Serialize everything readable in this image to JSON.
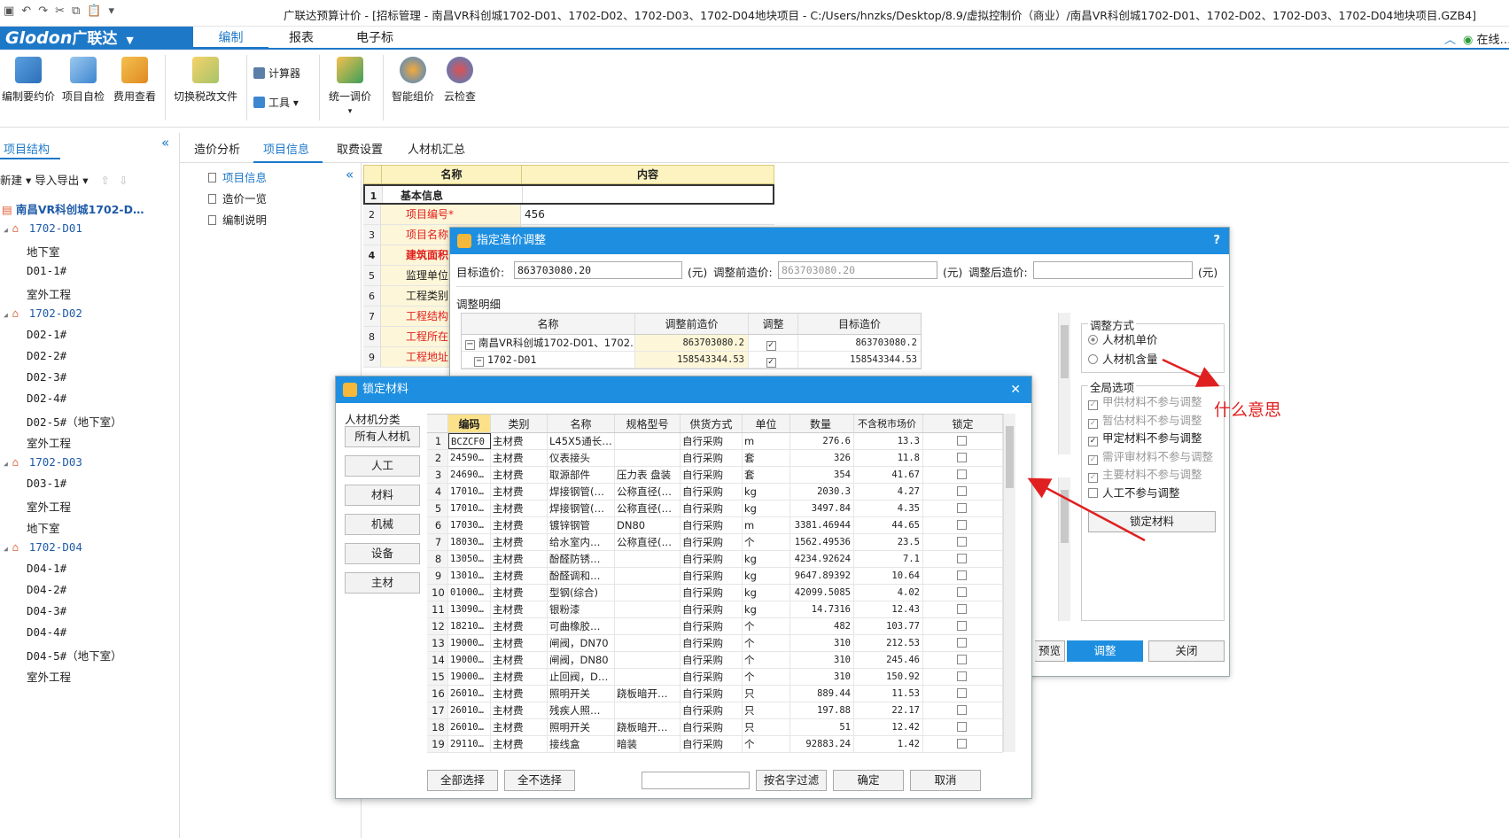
{
  "title": "广联达预算计价 - [招标管理 - 南昌VR科创城1702-D01、1702-D02、1702-D03、1702-D04地块项目 - C:/Users/hnzks/Desktop/8.9/虚拟控制价（商业）/南昌VR科创城1702-D01、1702-D02、1702-D03、1702-D04地块项目.GZB4]",
  "logo": {
    "brand": "Glodon",
    "cn": "广联达"
  },
  "menu": {
    "edit": "编制",
    "report": "报表",
    "ebid": "电子标"
  },
  "online": "在线…",
  "ribbon": {
    "b1": "编制要约价",
    "b2": "项目自检",
    "b3": "费用查看",
    "b4": "切换税改文件",
    "calc": "计算器",
    "tools": "工具",
    "b5": "统一调价",
    "b6": "智能组价",
    "b7": "云检查"
  },
  "left": {
    "tab": "项目结构",
    "tools": "新建 ▾   导入导出 ▾",
    "root": "南昌VR科创城1702-D…",
    "items": [
      {
        "t": "1702-D01",
        "lvl": "grp"
      },
      {
        "t": "地下室",
        "lvl": "leaf"
      },
      {
        "t": "D01-1#",
        "lvl": "leaf"
      },
      {
        "t": "室外工程",
        "lvl": "leaf"
      },
      {
        "t": "1702-D02",
        "lvl": "grp"
      },
      {
        "t": "D02-1#",
        "lvl": "leaf"
      },
      {
        "t": "D02-2#",
        "lvl": "leaf"
      },
      {
        "t": "D02-3#",
        "lvl": "leaf"
      },
      {
        "t": "D02-4#",
        "lvl": "leaf"
      },
      {
        "t": "D02-5#（地下室）",
        "lvl": "leaf"
      },
      {
        "t": "室外工程",
        "lvl": "leaf"
      },
      {
        "t": "1702-D03",
        "lvl": "grp"
      },
      {
        "t": "D03-1#",
        "lvl": "leaf"
      },
      {
        "t": "室外工程",
        "lvl": "leaf"
      },
      {
        "t": "地下室",
        "lvl": "leaf"
      },
      {
        "t": "1702-D04",
        "lvl": "grp"
      },
      {
        "t": "D04-1#",
        "lvl": "leaf"
      },
      {
        "t": "D04-2#",
        "lvl": "leaf"
      },
      {
        "t": "D04-3#",
        "lvl": "leaf"
      },
      {
        "t": "D04-4#",
        "lvl": "leaf"
      },
      {
        "t": "D04-5#（地下室）",
        "lvl": "leaf"
      },
      {
        "t": "室外工程",
        "lvl": "leaf"
      }
    ]
  },
  "subtabs": {
    "a": "造价分析",
    "b": "项目信息",
    "c": "取费设置",
    "d": "人材机汇总"
  },
  "infonav": {
    "a": "项目信息",
    "b": "造价一览",
    "c": "编制说明"
  },
  "infogrid": {
    "h_name": "名称",
    "h_content": "内容",
    "rows": [
      {
        "n": "1",
        "name": "基本信息",
        "val": "",
        "style": "group"
      },
      {
        "n": "2",
        "name": "项目编号*",
        "val": "456",
        "style": "red"
      },
      {
        "n": "3",
        "name": "项目名称",
        "val": "",
        "style": "red"
      },
      {
        "n": "4",
        "name": "建筑面积",
        "val": "",
        "style": "redbold"
      },
      {
        "n": "5",
        "name": "监理单位",
        "val": "",
        "style": "normal"
      },
      {
        "n": "6",
        "name": "工程类别",
        "val": "",
        "style": "normal"
      },
      {
        "n": "7",
        "name": "工程结构",
        "val": "",
        "style": "red"
      },
      {
        "n": "8",
        "name": "工程所在",
        "val": "",
        "style": "red"
      },
      {
        "n": "9",
        "name": "工程地址",
        "val": "",
        "style": "red"
      }
    ]
  },
  "dlg_price": {
    "title": "指定造价调整",
    "help": "?",
    "target_label": "目标造价:",
    "target_val": "863703080.20",
    "unit": "(元)",
    "before_label": "调整前造价:",
    "before_val": "863703080.20",
    "after_label": "调整后造价:",
    "after_val": "",
    "detail_label": "调整明细",
    "cols": [
      "名称",
      "调整前造价",
      "调整",
      "目标造价"
    ],
    "rows": [
      {
        "name": "南昌VR科创城1702-D01、1702…",
        "before": "863703080.2",
        "target": "863703080.2"
      },
      {
        "name": "1702-D01",
        "before": "158543344.53",
        "target": "158543344.53"
      }
    ],
    "mode_label": "调整方式",
    "mode_opts": [
      "人材机单价",
      "人材机含量"
    ],
    "global_label": "全局选项",
    "global_opts": [
      {
        "t": "甲供材料不参与调整",
        "checked": true,
        "dis": true
      },
      {
        "t": "暂估材料不参与调整",
        "checked": true,
        "dis": true
      },
      {
        "t": "甲定材料不参与调整",
        "checked": true,
        "dis": false
      },
      {
        "t": "需评审材料不参与调整",
        "checked": true,
        "dis": true
      },
      {
        "t": "主要材料不参与调整",
        "checked": true,
        "dis": true
      },
      {
        "t": "人工不参与调整",
        "checked": false,
        "dis": false
      }
    ],
    "lock_btn": "锁定材料",
    "preview": "预览",
    "adjust": "调整",
    "close": "关闭"
  },
  "dlg_lock": {
    "title": "锁定材料",
    "close": "✕",
    "cat_label": "人材机分类",
    "cats": [
      "所有人材机",
      "人工",
      "材料",
      "机械",
      "设备",
      "主材"
    ],
    "cols": [
      "编码",
      "类别",
      "名称",
      "规格型号",
      "供货方式",
      "单位",
      "数量",
      "不含税市场价",
      "锁定"
    ],
    "rows": [
      [
        "1",
        "BCZCF0",
        "主材费",
        "L45X5通长…",
        "",
        "自行采购",
        "m",
        "276.6",
        "13.3"
      ],
      [
        "2",
        "24590…",
        "主材费",
        "仪表接头",
        "",
        "自行采购",
        "套",
        "326",
        "11.8"
      ],
      [
        "3",
        "24690…",
        "主材费",
        "取源部件",
        "压力表 盘装",
        "自行采购",
        "套",
        "354",
        "41.67"
      ],
      [
        "4",
        "17010…",
        "主材费",
        "焊接钢管(…",
        "公称直径(…",
        "自行采购",
        "kg",
        "2030.3",
        "4.27"
      ],
      [
        "5",
        "17010…",
        "主材费",
        "焊接钢管(…",
        "公称直径(…",
        "自行采购",
        "kg",
        "3497.84",
        "4.35"
      ],
      [
        "6",
        "17030…",
        "主材费",
        "镀锌钢管",
        "DN80",
        "自行采购",
        "m",
        "3381.46944",
        "44.65"
      ],
      [
        "7",
        "18030…",
        "主材费",
        "给水室内…",
        "公称直径(…",
        "自行采购",
        "个",
        "1562.49536",
        "23.5"
      ],
      [
        "8",
        "13050…",
        "主材费",
        "酚醛防锈…",
        "",
        "自行采购",
        "kg",
        "4234.92624",
        "7.1"
      ],
      [
        "9",
        "13010…",
        "主材费",
        "酚醛调和…",
        "",
        "自行采购",
        "kg",
        "9647.89392",
        "10.64"
      ],
      [
        "10",
        "01000…",
        "主材费",
        "型钢(综合)",
        "",
        "自行采购",
        "kg",
        "42099.5085",
        "4.02"
      ],
      [
        "11",
        "13090…",
        "主材费",
        "银粉漆",
        "",
        "自行采购",
        "kg",
        "14.7316",
        "12.43"
      ],
      [
        "12",
        "18210…",
        "主材费",
        "可曲橡胶…",
        "",
        "自行采购",
        "个",
        "482",
        "103.77"
      ],
      [
        "13",
        "19000…",
        "主材费",
        "闸阀，DN70",
        "",
        "自行采购",
        "个",
        "310",
        "212.53"
      ],
      [
        "14",
        "19000…",
        "主材费",
        "闸阀，DN80",
        "",
        "自行采购",
        "个",
        "310",
        "245.46"
      ],
      [
        "15",
        "19000…",
        "主材费",
        "止回阀，D…",
        "",
        "自行采购",
        "个",
        "310",
        "150.92"
      ],
      [
        "16",
        "26010…",
        "主材费",
        "照明开关",
        "跷板暗开…",
        "自行采购",
        "只",
        "889.44",
        "11.53"
      ],
      [
        "17",
        "26010…",
        "主材费",
        "残疾人照…",
        "",
        "自行采购",
        "只",
        "197.88",
        "22.17"
      ],
      [
        "18",
        "26010…",
        "主材费",
        "照明开关",
        "跷板暗开…",
        "自行采购",
        "只",
        "51",
        "12.42"
      ],
      [
        "19",
        "29110…",
        "主材费",
        "接线盒",
        "暗装",
        "自行采购",
        "个",
        "92883.24",
        "1.42"
      ]
    ],
    "btn_all": "全部选择",
    "btn_none": "全不选择",
    "filter_val": "",
    "btn_filter": "按名字过滤",
    "btn_ok": "确定",
    "btn_cancel": "取消"
  },
  "annotation": "什么意思",
  "colors": {
    "accent": "#1e78c8",
    "dialog_title": "#1e8fe0",
    "annotation": "#e02020"
  }
}
